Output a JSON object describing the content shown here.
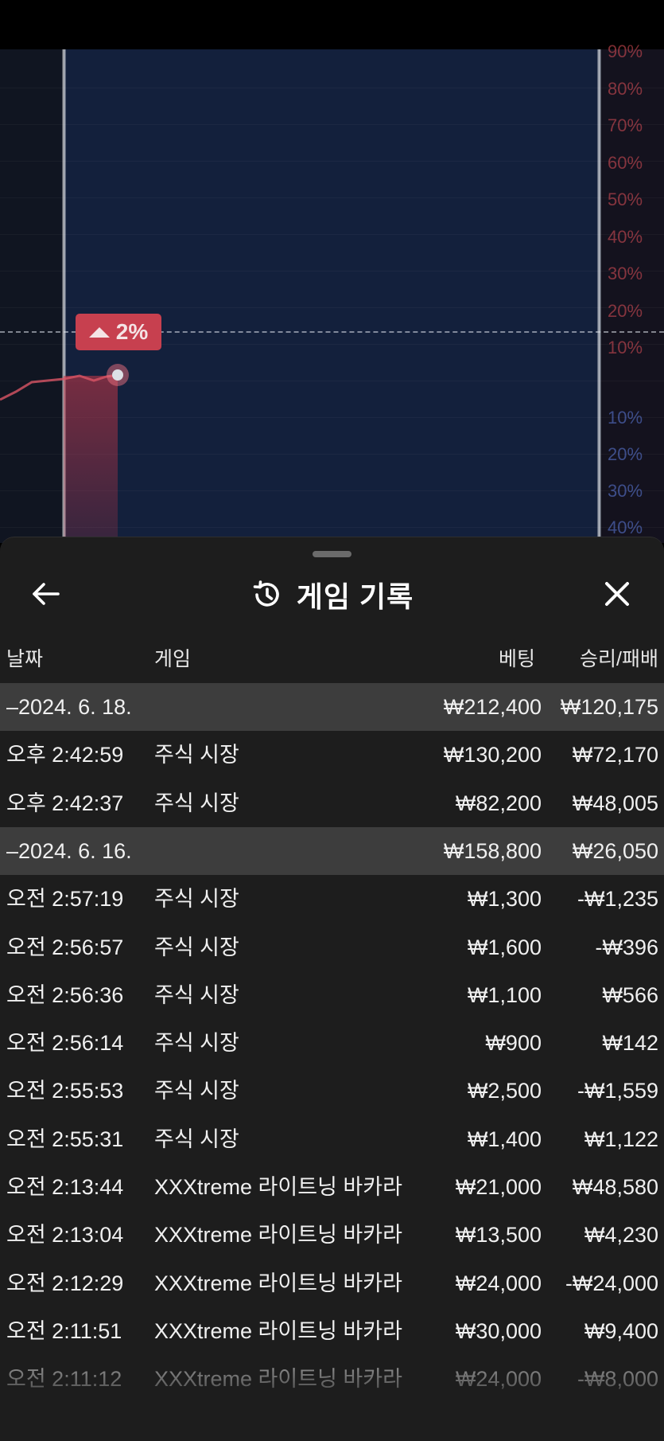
{
  "chart": {
    "percent_labels_up": [
      "90%",
      "80%",
      "70%",
      "60%",
      "50%",
      "40%",
      "30%",
      "20%",
      "10%"
    ],
    "percent_labels_down": [
      "10%",
      "20%",
      "30%",
      "40%"
    ],
    "change_badge": "2%",
    "colors": {
      "up": "#c7404f",
      "down": "#5f7de1",
      "window": "#13203c"
    }
  },
  "sheet": {
    "title": "게임 기록",
    "icons": {
      "back": "arrow-left-icon",
      "history": "history-clock-icon",
      "close": "close-icon"
    }
  },
  "table": {
    "columns": {
      "date": "날짜",
      "game": "게임",
      "bet": "베팅",
      "result": "승리/패배"
    },
    "rows": [
      {
        "kind": "date",
        "time": "–2024. 6. 18.",
        "game": "",
        "bet": "₩212,400",
        "result": "₩120,175"
      },
      {
        "kind": "entry",
        "time": "오후 2:42:59",
        "game": "주식 시장",
        "bet": "₩130,200",
        "result": "₩72,170"
      },
      {
        "kind": "entry",
        "time": "오후 2:42:37",
        "game": "주식 시장",
        "bet": "₩82,200",
        "result": "₩48,005"
      },
      {
        "kind": "date",
        "time": "–2024. 6. 16.",
        "game": "",
        "bet": "₩158,800",
        "result": "₩26,050"
      },
      {
        "kind": "entry",
        "time": "오전 2:57:19",
        "game": "주식 시장",
        "bet": "₩1,300",
        "result": "-₩1,235"
      },
      {
        "kind": "entry",
        "time": "오전 2:56:57",
        "game": "주식 시장",
        "bet": "₩1,600",
        "result": "-₩396"
      },
      {
        "kind": "entry",
        "time": "오전 2:56:36",
        "game": "주식 시장",
        "bet": "₩1,100",
        "result": "₩566"
      },
      {
        "kind": "entry",
        "time": "오전 2:56:14",
        "game": "주식 시장",
        "bet": "₩900",
        "result": "₩142"
      },
      {
        "kind": "entry",
        "time": "오전 2:55:53",
        "game": "주식 시장",
        "bet": "₩2,500",
        "result": "-₩1,559"
      },
      {
        "kind": "entry",
        "time": "오전 2:55:31",
        "game": "주식 시장",
        "bet": "₩1,400",
        "result": "₩1,122"
      },
      {
        "kind": "entry",
        "time": "오전 2:13:44",
        "game": "XXXtreme 라이트닝 바카라",
        "bet": "₩21,000",
        "result": "₩48,580"
      },
      {
        "kind": "entry",
        "time": "오전 2:13:04",
        "game": "XXXtreme 라이트닝 바카라",
        "bet": "₩13,500",
        "result": "₩4,230"
      },
      {
        "kind": "entry",
        "time": "오전 2:12:29",
        "game": "XXXtreme 라이트닝 바카라",
        "bet": "₩24,000",
        "result": "-₩24,000"
      },
      {
        "kind": "entry",
        "time": "오전 2:11:51",
        "game": "XXXtreme 라이트닝 바카라",
        "bet": "₩30,000",
        "result": "₩9,400"
      },
      {
        "kind": "entry",
        "time": "오전 2:11:12",
        "game": "XXXtreme 라이트닝 바카라",
        "bet": "₩24,000",
        "result": "-₩8,000"
      }
    ]
  }
}
